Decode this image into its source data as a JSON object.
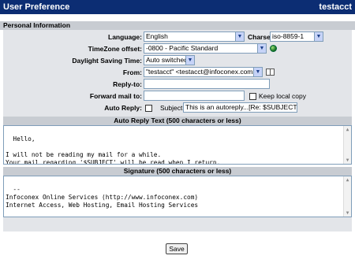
{
  "titlebar": {
    "title": "User Preference",
    "username": "testacct"
  },
  "section": {
    "title": "Personal Information"
  },
  "fields": {
    "language": {
      "label": "Language:",
      "value": "English"
    },
    "charset": {
      "label": "Charset",
      "value": "iso-8859-1"
    },
    "timezone": {
      "label": "TimeZone offset:",
      "value": "-0800 - Pacific Standard"
    },
    "dst": {
      "label": "Daylight Saving Time:",
      "value": "Auto switched"
    },
    "from": {
      "label": "From:",
      "value": "\"testacct\" <testacct@infoconex.com>"
    },
    "reply_to": {
      "label": "Reply-to:",
      "value": ""
    },
    "forward": {
      "label": "Forward mail to:",
      "value": "",
      "keep_local_label": "Keep local copy"
    },
    "auto_reply": {
      "label": "Auto Reply:",
      "subject_label": "Subject:",
      "subject_value": "This is an autoreply...[Re: $SUBJECT]"
    }
  },
  "auto_reply_text": {
    "title": "Auto Reply Text (500 characters or less)",
    "content": "Hello,\n\nI will not be reading my mail for a while.\nYour mail regarding '$SUBJECT' will be read when I return."
  },
  "signature": {
    "title": "Signature (500 characters or less)",
    "content": "--\nInfoconex Online Services (http://www.infoconex.com)\nInternet Access, Web Hosting, Email Hosting Services"
  },
  "actions": {
    "save_label": "Save"
  },
  "icons": {
    "timezone_icon": "globe-icon",
    "address_book_icon": "address-book-icon"
  },
  "colors": {
    "titlebar": "#0c2d73",
    "header_bg": "#c8ccd2",
    "form_bg": "#e3e5e9"
  }
}
